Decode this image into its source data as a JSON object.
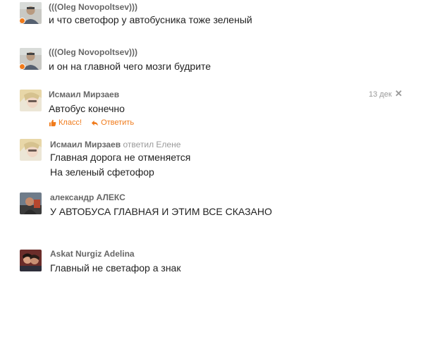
{
  "comments": [
    {
      "author": "(((Oleg Novopoltsev)))",
      "lines": [
        "и что светофор у автобусника тоже зеленый"
      ],
      "online": true
    },
    {
      "author": "(((Oleg Novopoltsev)))",
      "lines": [
        "и он на главной чего мозги будрите"
      ],
      "online": true
    },
    {
      "author": "Исмаил Мирзаев",
      "lines": [
        "Автобус конечно"
      ],
      "date": "13 дек",
      "close": "✕",
      "like_label": "Класс!",
      "reply_label": "Ответить"
    },
    {
      "author": "Исмаил Мирзаев",
      "reply_note": "ответил Елене",
      "lines": [
        "Главная дорога не отменяется",
        "На зеленый сфетофор"
      ]
    },
    {
      "author": "александр АЛЕКС",
      "lines": [
        "У АВТОБУСА ГЛАВНАЯ И ЭТИМ ВСЕ СКАЗАНО"
      ]
    },
    {
      "author": "Askat Nurgiz Adelina",
      "lines": [
        "Главный не светафор а знак"
      ]
    }
  ],
  "colors": {
    "accent": "#f07a1a",
    "author": "#666666",
    "text": "#222222",
    "muted": "#999999"
  }
}
